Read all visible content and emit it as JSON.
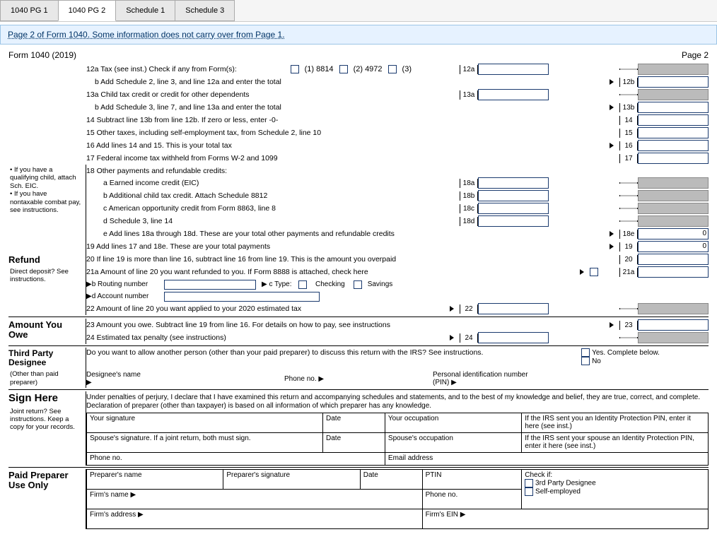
{
  "tabs": {
    "t1": "1040 PG 1",
    "t2": "1040 PG 2",
    "t3": "Schedule 1",
    "t4": "Schedule 3"
  },
  "info_bar": "Page 2 of Form 1040. Some information does not carry over from Page 1.",
  "form_id": "Form 1040 (2019)",
  "page_label": "Page 2",
  "sidebar_note1": "• If you have a qualifying child, attach Sch. EIC.\n• If you have nontaxable combat pay, see instructions.",
  "refund_title": "Refund",
  "dd_note": "Direct deposit? See instructions.",
  "owe_title": "Amount You Owe",
  "third_title": "Third Party Designee",
  "other_prep_note": "(Other than paid preparer)",
  "sign_title": "Sign Here",
  "joint_note": "Joint return? See instructions. Keep a copy for your records.",
  "paid_title": "Paid Preparer Use Only",
  "lines": {
    "l12a": "12a Tax (see inst.) Check if any from Form(s):",
    "l12a_1": "(1) 8814",
    "l12a_2": "(2) 4972",
    "l12a_3": "(3)",
    "n12a": "12a",
    "l12b": "b Add Schedule 2, line 3, and line 12a and enter the total",
    "n12b": "12b",
    "l13a": "13a Child tax credit or credit for other dependents",
    "n13a": "13a",
    "l13b": "b Add Schedule 3, line 7, and line 13a and enter the total",
    "n13b": "13b",
    "l14": "14 Subtract line 13b from line 12b. If zero or less, enter -0-",
    "n14": "14",
    "l15": "15 Other taxes, including self-employment tax, from Schedule 2, line 10",
    "n15": "15",
    "l16": "16 Add lines 14 and 15. This is your total tax",
    "n16": "16",
    "l17": "17 Federal income tax withheld from Forms W-2 and 1099",
    "n17": "17",
    "l18": "18 Other payments and refundable credits:",
    "l18a": "a Earned income credit (EIC)",
    "n18a": "18a",
    "l18b": "b Additional child tax credit. Attach Schedule 8812",
    "n18b": "18b",
    "l18c": "c American opportunity credit from Form 8863, line 8",
    "n18c": "18c",
    "l18d": "d Schedule 3, line 14",
    "n18d": "18d",
    "l18e": "e Add lines 18a through 18d. These are your total other payments and refundable credits",
    "n18e": "18e",
    "v18e": "0",
    "l19": "19 Add lines 17 and 18e. These are your total payments",
    "n19": "19",
    "v19": "0",
    "l20": "20 If line 19 is more than line 16, subtract line 16 from line 19. This is the amount you overpaid",
    "n20": "20",
    "l21a": "21a Amount of line 20 you want refunded to you. If Form 8888 is attached, check here",
    "n21a": "21a",
    "l21b": "▶b Routing number",
    "l21c": "▶ c Type:",
    "l21c_chk": "Checking",
    "l21c_sav": "Savings",
    "l21d": "▶d Account number",
    "l22": "22 Amount of line 20 you want applied to your 2020 estimated tax",
    "n22": "22",
    "l23": "23 Amount you owe. Subtract line 19 from line 16. For details on how to pay, see instructions",
    "n23": "23",
    "l24": "24 Estimated tax penalty (see instructions)",
    "n24": "24"
  },
  "third": {
    "q": "Do you want to allow another person (other than your paid preparer) to discuss this return with the IRS? See instructions.",
    "yes": "Yes. Complete below.",
    "no": "No",
    "designee": "Designee's name ▶",
    "phone": "Phone no. ▶",
    "pin": "Personal identification number (PIN) ▶"
  },
  "sign": {
    "declaration": "Under penalties of perjury, I declare that I have examined this return and accompanying schedules and statements, and to the best of my knowledge and belief, they are true, correct, and complete. Declaration of preparer (other than taxpayer) is based on all information of which preparer has any knowledge.",
    "your_sig": "Your signature",
    "date": "Date",
    "your_occ": "Your occupation",
    "irs_pin_you": "If the IRS sent you an Identity Protection PIN, enter it here (see inst.)",
    "spouse_sig": "Spouse's signature. If a joint return, both must sign.",
    "spouse_occ": "Spouse's occupation",
    "irs_pin_spouse": "If the IRS sent your spouse an Identity Protection PIN, enter it here (see inst.)",
    "phone": "Phone no.",
    "email": "Email address"
  },
  "paid": {
    "prep_name": "Preparer's name",
    "prep_sig": "Preparer's signature",
    "date": "Date",
    "ptin": "PTIN",
    "check_if": "Check if:",
    "third": "3rd Party Designee",
    "self": "Self-employed",
    "firm_name": "Firm's name ▶",
    "phone": "Phone no.",
    "firm_addr": "Firm's address ▶",
    "firm_ein": "Firm's EIN ▶"
  }
}
